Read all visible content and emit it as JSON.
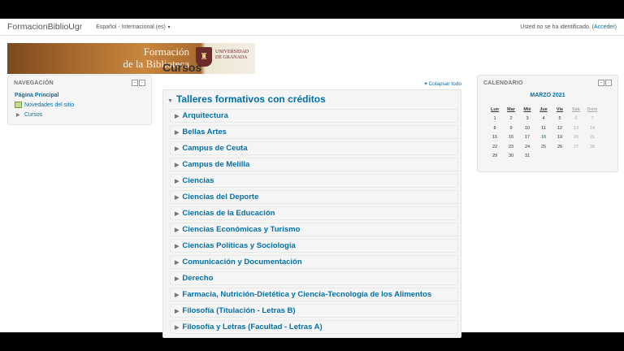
{
  "topbar": {
    "brand": "FormacionBiblioUgr",
    "language": "Español - Internacional (es)",
    "login_text": "Usted no se ha identificado. (",
    "login_link": "Acceder",
    "login_end": ")"
  },
  "banner": {
    "line1": "Formación",
    "line2": "de la Biblioteca",
    "ugr_line1": "UNIVERSIDAD",
    "ugr_line2": "DE GRANADA"
  },
  "navigation": {
    "title": "NAVEGACIÓN",
    "items": [
      "Página Principal",
      "Novedades del sitio",
      "Cursos"
    ]
  },
  "main": {
    "title": "Cursos",
    "collapse_all": "Colapsar todo",
    "category": "Talleres formativos con créditos",
    "subcategories": [
      "Arquitectura",
      "Bellas Artes",
      "Campus de Ceuta",
      "Campus de Melilla",
      "Ciencias",
      "Ciencias del Deporte",
      "Ciencias de la Educación",
      "Ciencias Económicas y Turismo",
      "Ciencias Políticas y Sociología",
      "Comunicación y Documentación",
      "Derecho",
      "Farmacia, Nutrición-Dietética y Ciencia-Tecnología de los Alimentos",
      "Filosofía (Titulación - Letras B)",
      "Filosofía y Letras (Facultad - Letras A)"
    ]
  },
  "calendar": {
    "title": "CALENDARIO",
    "month": "MARZO 2021",
    "days": [
      "Lun",
      "Mar",
      "Mié",
      "Jue",
      "Vie",
      "Sáb",
      "Dom"
    ],
    "weeks": [
      [
        "1",
        "2",
        "3",
        "4",
        "5",
        "6",
        "7"
      ],
      [
        "8",
        "9",
        "10",
        "11",
        "12",
        "13",
        "14"
      ],
      [
        "15",
        "16",
        "17",
        "18",
        "19",
        "20",
        "21"
      ],
      [
        "22",
        "23",
        "24",
        "25",
        "26",
        "27",
        "28"
      ],
      [
        "29",
        "30",
        "31",
        "",
        "",
        "",
        ""
      ]
    ],
    "today": "18"
  }
}
